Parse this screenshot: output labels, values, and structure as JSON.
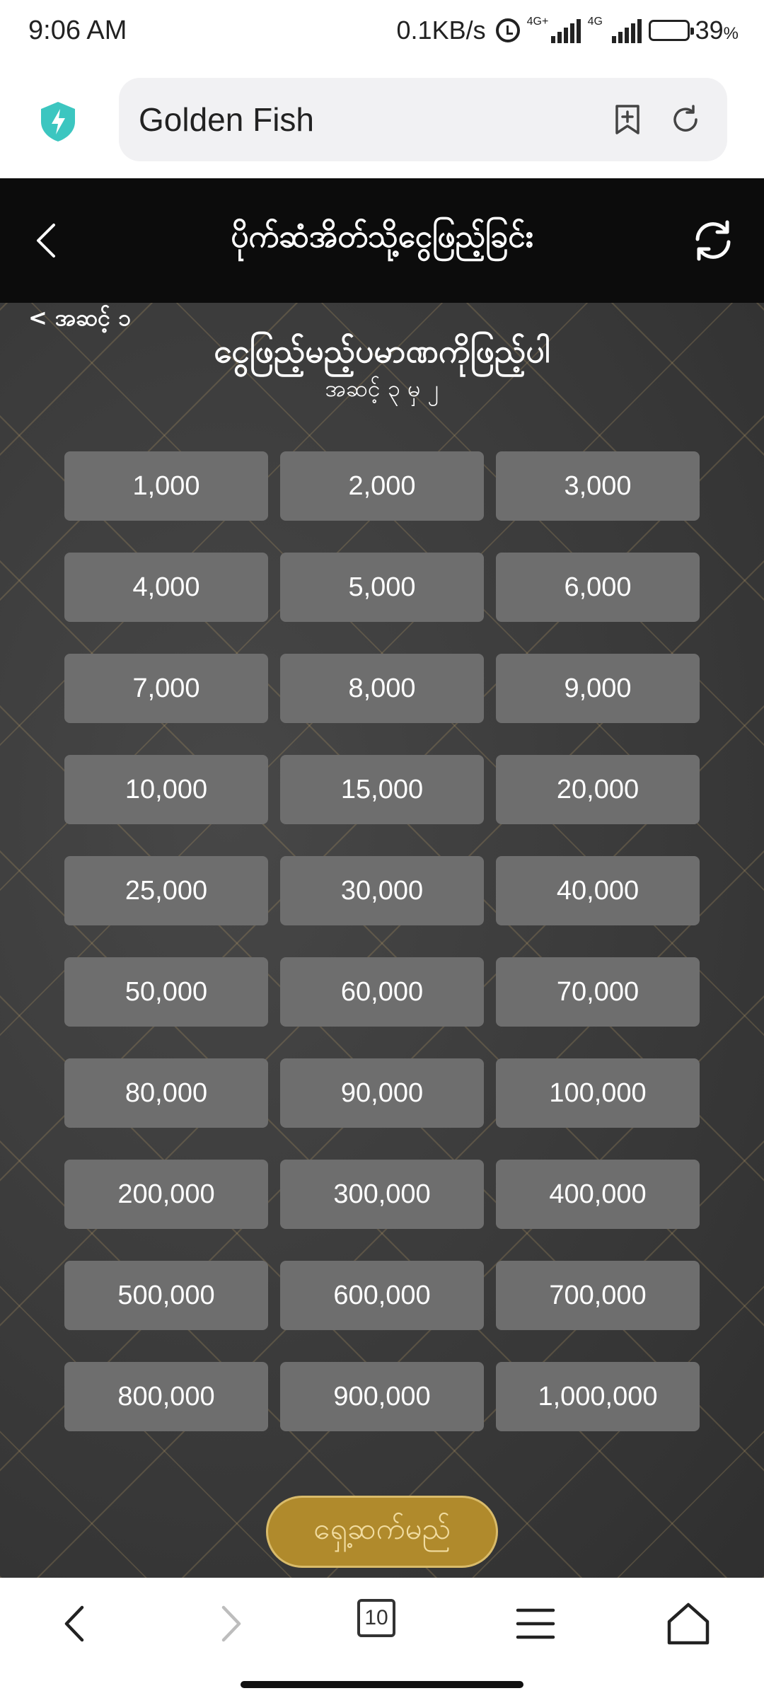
{
  "status_bar": {
    "time": "9:06 AM",
    "net_speed": "0.1KB/s",
    "signal1_label": "4G+",
    "signal2_label": "4G",
    "battery_percent": "39",
    "battery_unit": "%"
  },
  "browser": {
    "url_text": "Golden Fish"
  },
  "header": {
    "title": "ပိုက်ဆံအိတ်သို့ငွေဖြည့်ခြင်း"
  },
  "main": {
    "step_back_label": "< အဆင့် ၁",
    "title": "ငွေဖြည့်မည့်ပမာဏကိုဖြည့်ပါ",
    "subtitle": "အဆင့် ၃ မှ ၂",
    "amounts": [
      "1,000",
      "2,000",
      "3,000",
      "4,000",
      "5,000",
      "6,000",
      "7,000",
      "8,000",
      "9,000",
      "10,000",
      "15,000",
      "20,000",
      "25,000",
      "30,000",
      "40,000",
      "50,000",
      "60,000",
      "70,000",
      "80,000",
      "90,000",
      "100,000",
      "200,000",
      "300,000",
      "400,000",
      "500,000",
      "600,000",
      "700,000",
      "800,000",
      "900,000",
      "1,000,000"
    ],
    "continue_label": "ရှေ့ဆက်မည်"
  },
  "bottom_nav": {
    "tab_count": "10"
  },
  "colors": {
    "header_bg": "#0c0c0c",
    "button_bg": "#6e6e6e",
    "accent_gold": "#b08a2c",
    "shield": "#3cc6c0"
  }
}
